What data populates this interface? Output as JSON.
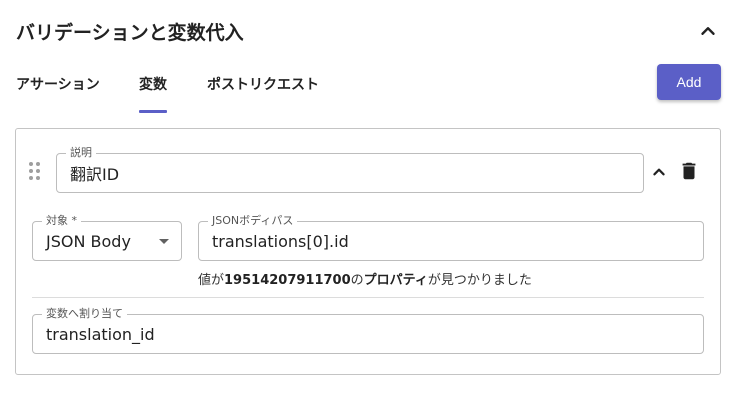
{
  "section": {
    "title": "バリデーションと変数代入"
  },
  "tabs": [
    {
      "label": "アサーション"
    },
    {
      "label": "変数"
    },
    {
      "label": "ポストリクエスト"
    }
  ],
  "active_tab": "変数",
  "add_button_label": "Add",
  "variable": {
    "description_label": "説明",
    "description_value": "翻訳ID",
    "target_label": "対象 *",
    "target_value": "JSON Body",
    "json_path_label": "JSONボディパス",
    "json_path_value": "translations[0].id",
    "helper_prefix": "値が",
    "helper_value": "19514207911700",
    "helper_middle": "の",
    "helper_property": "プロパティ",
    "helper_suffix": "が見つかりました",
    "assign_label": "変数へ割り当て",
    "assign_value": "translation_id"
  },
  "colors": {
    "accent": "#5b5fc7",
    "border": "#c4c4c4"
  },
  "icons": [
    "chevron-up-icon",
    "drag-handle-icon",
    "trash-icon",
    "select-arrow-icon"
  ]
}
